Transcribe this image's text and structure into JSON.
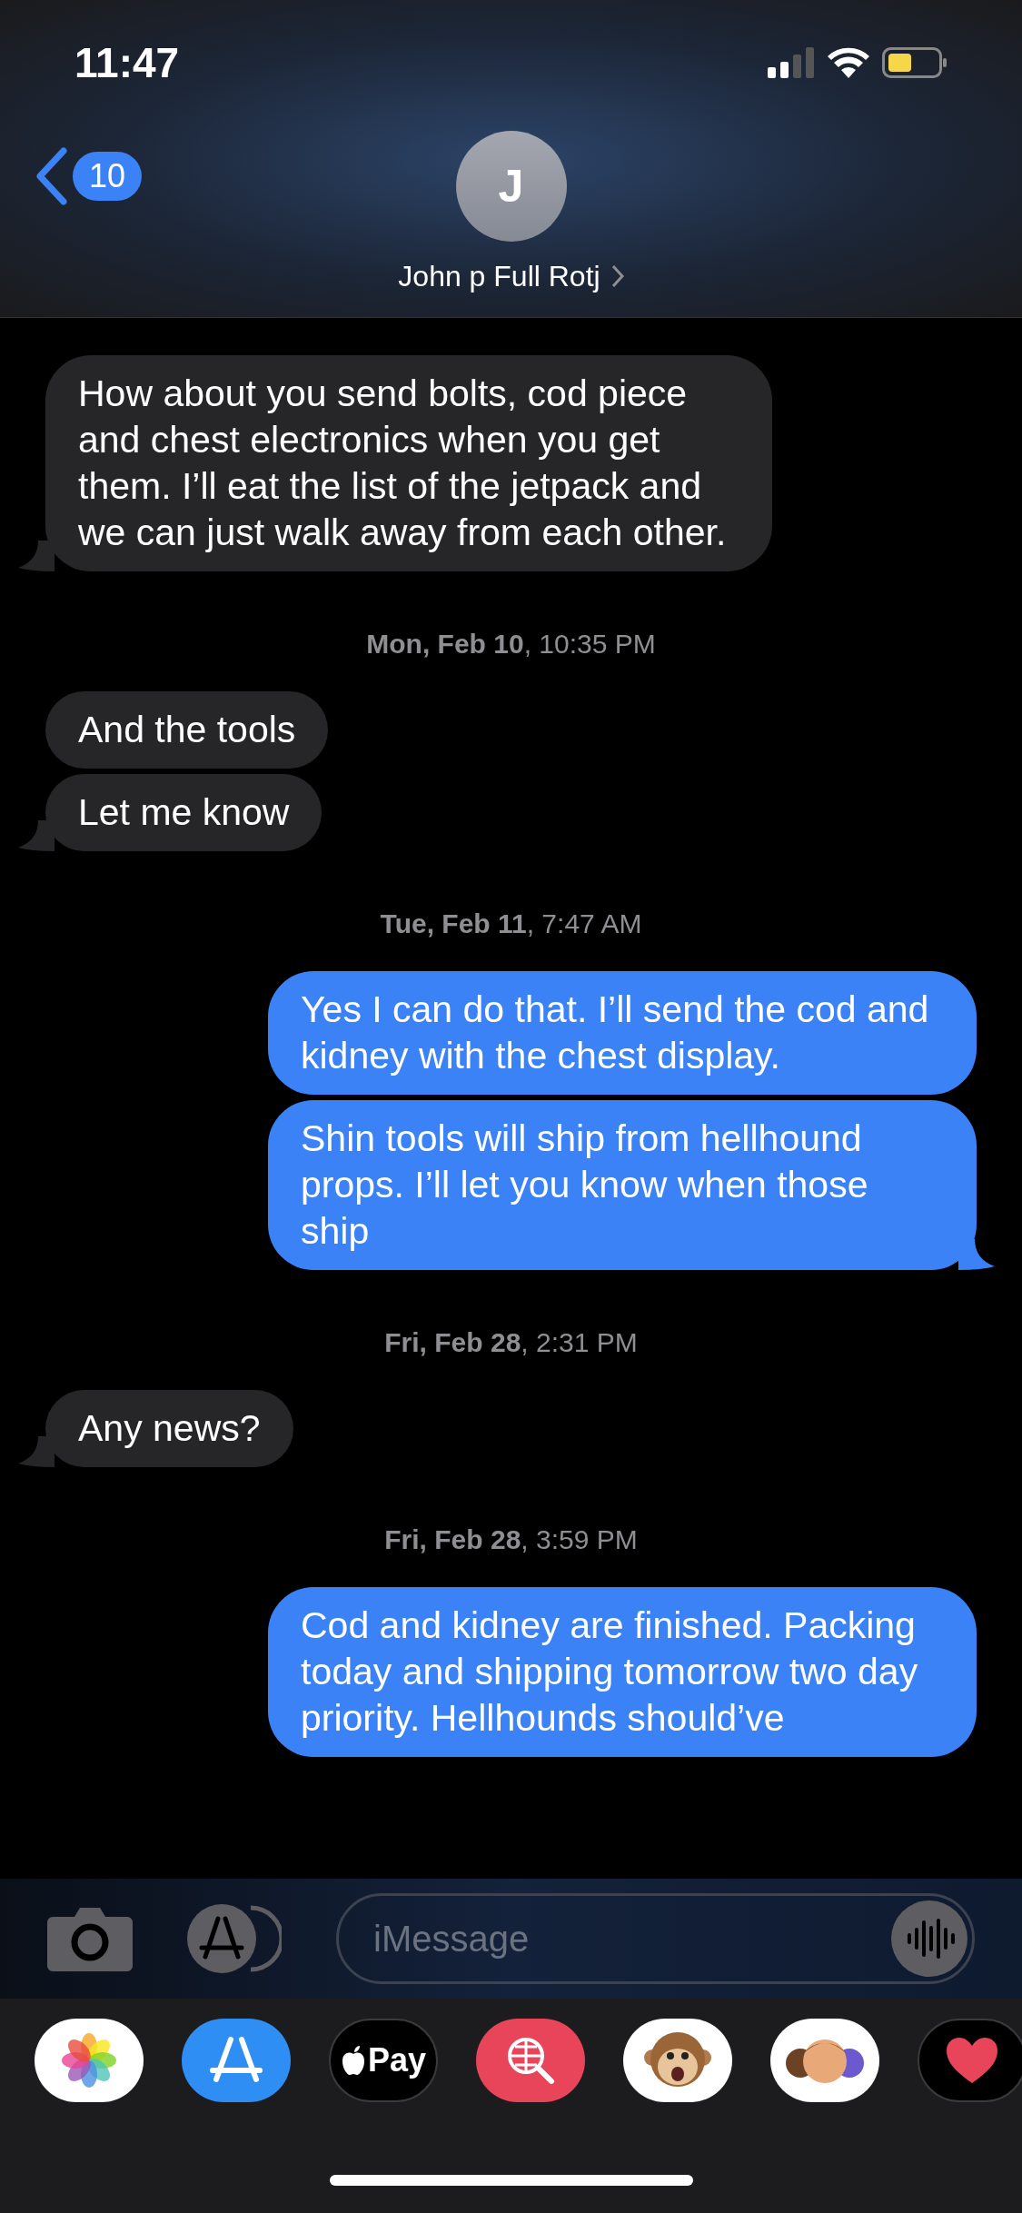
{
  "status_bar": {
    "time": "11:47"
  },
  "header": {
    "back_count": "10",
    "avatar_initial": "J",
    "contact_name": "John p Full Rotj"
  },
  "messages": [
    {
      "kind": "received",
      "text": "How about you send bolts, cod piece and chest electronics when you get them. I’ll eat the list of the jetpack and we can just walk away from each other.",
      "tail": true
    },
    {
      "kind": "timestamp",
      "text": "**Mon, Feb 10**, 10:35 PM"
    },
    {
      "kind": "received",
      "text": "And the tools",
      "tail": false
    },
    {
      "kind": "received",
      "text": "Let me know",
      "tail": true
    },
    {
      "kind": "timestamp",
      "text": "**Tue, Feb 11**, 7:47 AM"
    },
    {
      "kind": "sent",
      "text": "Yes I can do that. I’ll send the cod and kidney with the chest display.",
      "tail": false
    },
    {
      "kind": "sent",
      "text": "Shin tools will ship from hellhound props. I’ll let you know when those ship",
      "tail": true
    },
    {
      "kind": "timestamp",
      "text": "**Fri, Feb 28**, 2:31 PM"
    },
    {
      "kind": "received",
      "text": "Any news?",
      "tail": true
    },
    {
      "kind": "timestamp",
      "text": "**Fri, Feb 28**, 3:59 PM"
    },
    {
      "kind": "sent",
      "text": "Cod and kidney are finished. Packing today and shipping tomorrow two day priority. Hellhounds should’ve",
      "tail": false
    }
  ],
  "composer": {
    "placeholder": "iMessage"
  },
  "app_drawer": [
    {
      "kind": "photos"
    },
    {
      "kind": "store"
    },
    {
      "kind": "pay",
      "label": "Pay"
    },
    {
      "kind": "search"
    },
    {
      "kind": "monkey"
    },
    {
      "kind": "memoji"
    },
    {
      "kind": "heart"
    }
  ]
}
